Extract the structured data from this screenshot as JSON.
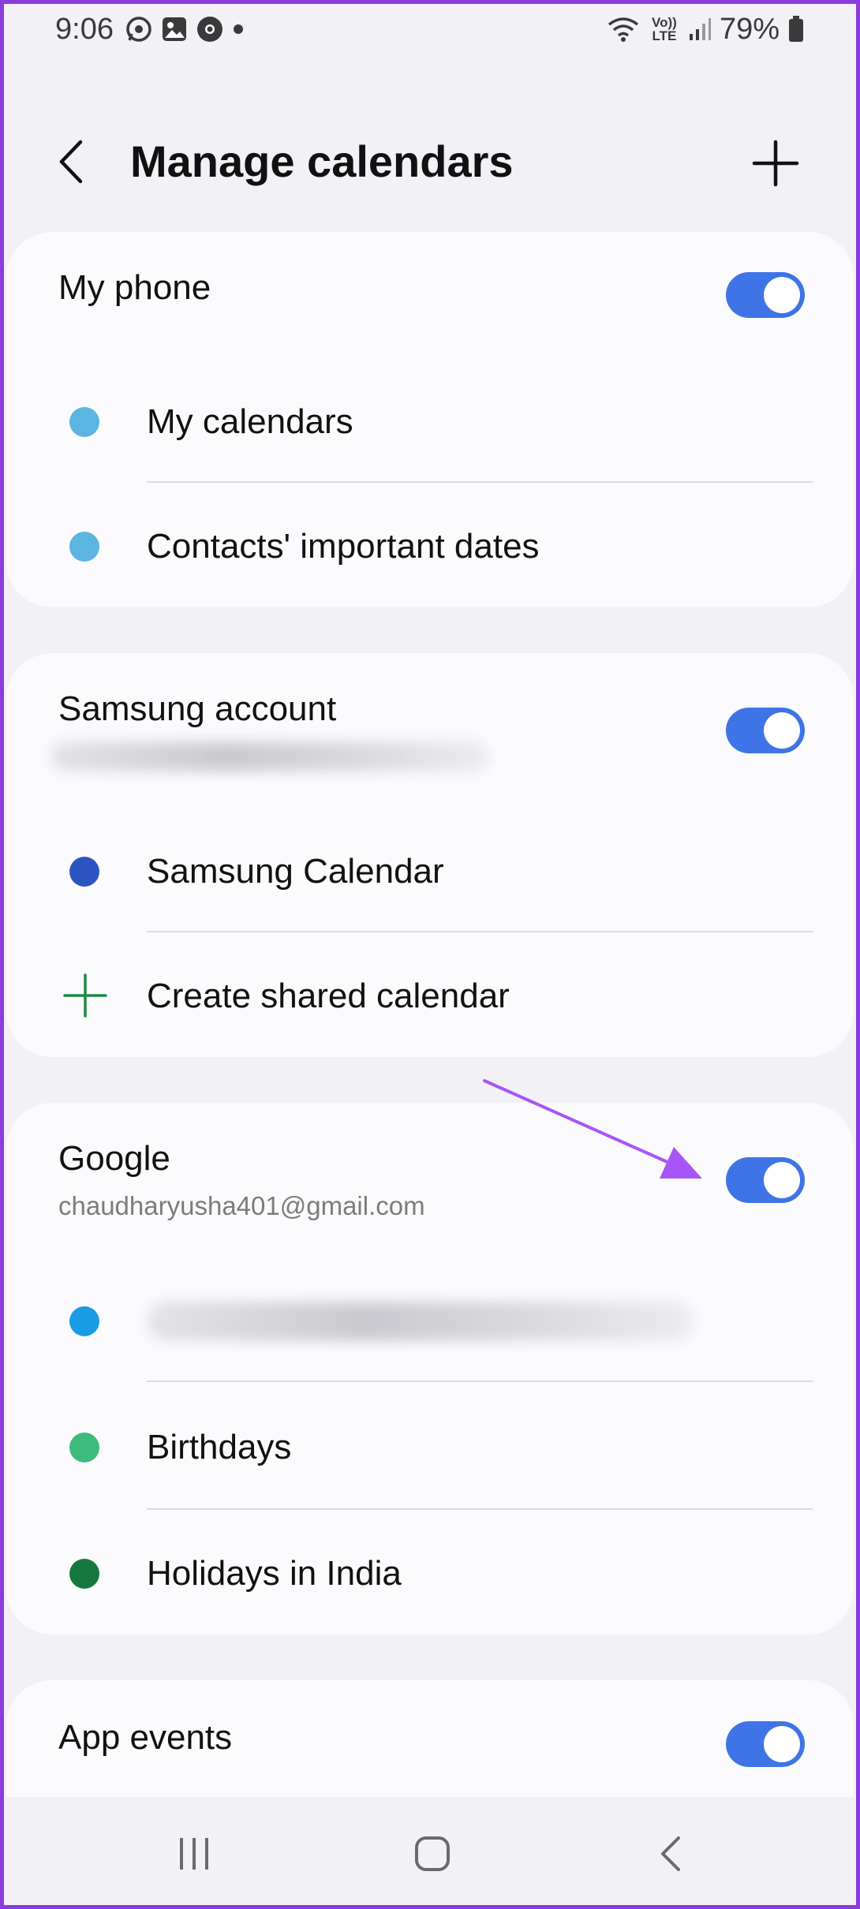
{
  "status_bar": {
    "time": "9:06",
    "battery": "79%",
    "network_label": "Vo)) LTE"
  },
  "header": {
    "title": "Manage calendars",
    "back_icon": "chevron-left-icon",
    "add_icon": "plus-icon"
  },
  "sections": {
    "my_phone": {
      "title": "My phone",
      "toggle_on": true,
      "items": [
        {
          "label": "My calendars",
          "color": "#5bb5e0"
        },
        {
          "label": "Contacts' important dates",
          "color": "#5bb5e0"
        }
      ]
    },
    "samsung": {
      "title": "Samsung account",
      "toggle_on": true,
      "items": [
        {
          "label": "Samsung Calendar",
          "color": "#2c55c2"
        },
        {
          "label": "Create shared calendar",
          "icon": "plus-icon",
          "color": "#1e8a47"
        }
      ]
    },
    "google": {
      "title": "Google",
      "subtitle": "chaudharyusha401@gmail.com",
      "toggle_on": true,
      "items": [
        {
          "label": "",
          "color": "#1a9be6"
        },
        {
          "label": "Birthdays",
          "color": "#3dbb7d"
        },
        {
          "label": "Holidays in India",
          "color": "#17783e"
        }
      ]
    },
    "app_events": {
      "title": "App events",
      "toggle_on": true
    }
  },
  "colors": {
    "accent": "#3f74e6",
    "annotation_arrow": "#a855f7"
  }
}
